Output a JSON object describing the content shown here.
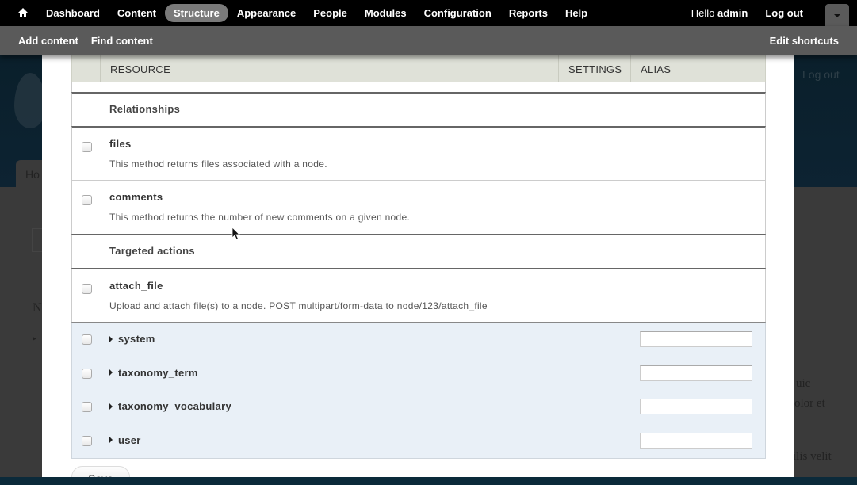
{
  "toolbar": {
    "home_icon": "home-icon",
    "nav": [
      {
        "label": "Dashboard",
        "active": false
      },
      {
        "label": "Content",
        "active": false
      },
      {
        "label": "Structure",
        "active": true
      },
      {
        "label": "Appearance",
        "active": false
      },
      {
        "label": "People",
        "active": false
      },
      {
        "label": "Modules",
        "active": false
      },
      {
        "label": "Configuration",
        "active": false
      },
      {
        "label": "Reports",
        "active": false
      },
      {
        "label": "Help",
        "active": false
      }
    ],
    "hello_prefix": "Hello ",
    "username": "admin",
    "logout": "Log out",
    "toggle_icon": "chevron-down-icon"
  },
  "shortcuts": {
    "items": [
      "Add content",
      "Find content"
    ],
    "edit": "Edit shortcuts"
  },
  "background": {
    "logout": "Log out",
    "tab": "Ho",
    "letter_n": "N",
    "right_text": [
      "uic",
      "olor et",
      "ilis velit"
    ]
  },
  "table": {
    "headers": {
      "resource": "RESOURCE",
      "settings": "SETTINGS",
      "alias": "ALIAS"
    },
    "groups": [
      {
        "title": "Relationships",
        "methods": [
          {
            "name": "files",
            "desc": "This method returns files associated with a node."
          },
          {
            "name": "comments",
            "desc": "This method returns the number of new comments on a given node."
          }
        ]
      },
      {
        "title": "Targeted actions",
        "methods": [
          {
            "name": "attach_file",
            "desc": "Upload and attach file(s) to a node. POST multipart/form-data to node/123/attach_file"
          }
        ]
      }
    ],
    "resources": [
      {
        "name": "system",
        "alias": ""
      },
      {
        "name": "taxonomy_term",
        "alias": ""
      },
      {
        "name": "taxonomy_vocabulary",
        "alias": ""
      },
      {
        "name": "user",
        "alias": ""
      }
    ]
  },
  "save_label": "Save",
  "colors": {
    "toolbar_bg": "#000000",
    "shortcuts_bg": "#5a5a5a",
    "active_tab_bg": "#7a7a7a",
    "header_bg": "#dfe1d8",
    "resource_area_bg": "#e9f0f7"
  }
}
